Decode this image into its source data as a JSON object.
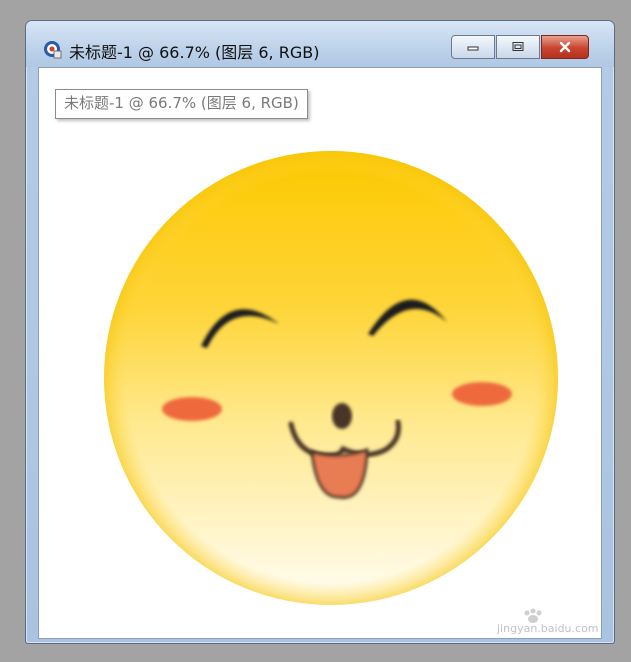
{
  "window": {
    "title": "未标题-1 @ 66.7% (图层 6, RGB)",
    "tooltip": "未标题-1 @ 66.7% (图层 6, RGB)"
  },
  "controls": {
    "minimize_icon": "minimize-icon",
    "maximize_icon": "maximize-icon",
    "close_icon": "close-icon"
  },
  "watermark": {
    "brand": "Baidu经验",
    "url": "jingyan.baidu.com"
  },
  "colors": {
    "face_top": "#fdc800",
    "face_bottom": "#fffdf4",
    "cheek": "#ee6a3c",
    "tongue": "#e87c52",
    "eye": "#1a1a1a",
    "close_button": "#c8442e"
  }
}
